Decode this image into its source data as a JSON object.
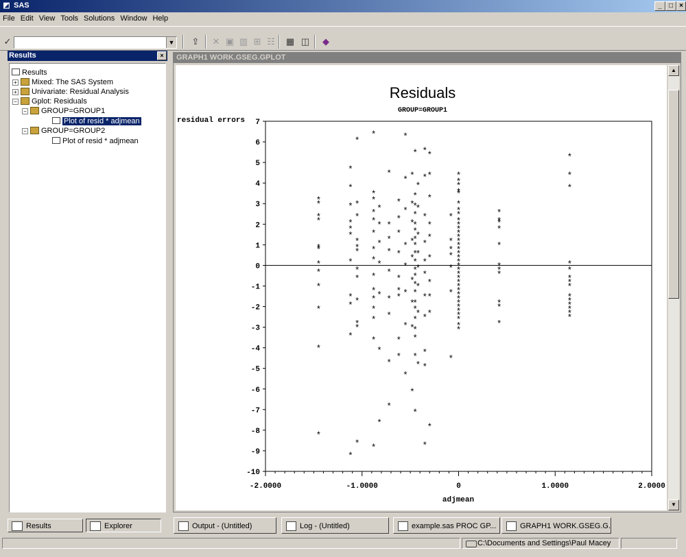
{
  "window": {
    "title": "SAS",
    "min": "_",
    "max": "□",
    "close": "×"
  },
  "menu": [
    "File",
    "Edit",
    "View",
    "Tools",
    "Solutions",
    "Window",
    "Help"
  ],
  "toolbar": {
    "check_glyph": "✓",
    "command_value": "",
    "drop_glyph": "▼"
  },
  "results": {
    "title": "Results",
    "close": "×",
    "tree": {
      "root": "Results",
      "mixed": "Mixed:  The SAS System",
      "univariate": "Univariate:  Residual Analysis",
      "gplot": "Gplot:  Residuals",
      "group1": "GROUP=GROUP1",
      "group1_plot": "Plot of resid * adjmean",
      "group2": "GROUP=GROUP2",
      "group2_plot": "Plot of resid * adjmean"
    },
    "tabs": [
      "Results",
      "Explorer"
    ]
  },
  "graph": {
    "window_title": "GRAPH1  WORK.GSEG.GPLOT"
  },
  "taskbar": [
    "Output - (Untitled)",
    "Log - (Untitled)",
    "example.sas   PROC GP...",
    "GRAPH1  WORK.GSEG.G..."
  ],
  "status": {
    "path": "C:\\Documents and Settings\\Paul Macey"
  },
  "chart_data": {
    "type": "scatter",
    "title": "Residuals",
    "subtitle": "GROUP=GROUP1",
    "ylabel": "residual errors",
    "xlabel": "adjmean",
    "marker": "*",
    "xlim": [
      -2.0,
      2.0
    ],
    "ylim": [
      -10,
      7
    ],
    "xticks": [
      "-2.0000",
      "-1.0000",
      "0",
      "1.0000",
      "2.0000"
    ],
    "yticks": [
      "7",
      "6",
      "5",
      "4",
      "3",
      "2",
      "1",
      "0",
      "-1",
      "-2",
      "-3",
      "-4",
      "-5",
      "-6",
      "-7",
      "-8",
      "-9",
      "-10"
    ],
    "reference_line_y": 0,
    "points": [
      [
        -1.45,
        3.2
      ],
      [
        -1.45,
        3.0
      ],
      [
        -1.45,
        2.4
      ],
      [
        -1.45,
        2.2
      ],
      [
        -1.45,
        0.9
      ],
      [
        -1.45,
        0.8
      ],
      [
        -1.45,
        0.1
      ],
      [
        -1.45,
        -0.3
      ],
      [
        -1.45,
        -1.0
      ],
      [
        -1.45,
        -2.1
      ],
      [
        -1.45,
        -4.0
      ],
      [
        -1.45,
        -8.2
      ],
      [
        -1.12,
        4.7
      ],
      [
        -1.12,
        3.8
      ],
      [
        -1.12,
        2.9
      ],
      [
        -1.12,
        2.1
      ],
      [
        -1.12,
        1.8
      ],
      [
        -1.12,
        1.5
      ],
      [
        -1.12,
        0.2
      ],
      [
        -1.12,
        -1.5
      ],
      [
        -1.12,
        -1.9
      ],
      [
        -1.12,
        -3.4
      ],
      [
        -1.12,
        -9.2
      ],
      [
        -1.05,
        6.1
      ],
      [
        -1.05,
        3.0
      ],
      [
        -1.05,
        2.4
      ],
      [
        -1.05,
        1.2
      ],
      [
        -1.05,
        0.9
      ],
      [
        -1.05,
        0.7
      ],
      [
        -1.05,
        -0.2
      ],
      [
        -1.05,
        -0.6
      ],
      [
        -1.05,
        -1.7
      ],
      [
        -1.05,
        -2.8
      ],
      [
        -1.05,
        -3.0
      ],
      [
        -1.05,
        -8.6
      ],
      [
        -0.88,
        6.4
      ],
      [
        -0.88,
        3.5
      ],
      [
        -0.88,
        3.2
      ],
      [
        -0.88,
        2.6
      ],
      [
        -0.88,
        2.2
      ],
      [
        -0.88,
        1.6
      ],
      [
        -0.88,
        0.8
      ],
      [
        -0.88,
        0.3
      ],
      [
        -0.88,
        -0.5
      ],
      [
        -0.88,
        -1.2
      ],
      [
        -0.88,
        -1.6
      ],
      [
        -0.88,
        -2.1
      ],
      [
        -0.88,
        -2.6
      ],
      [
        -0.88,
        -3.6
      ],
      [
        -0.88,
        -8.8
      ],
      [
        -0.82,
        2.8
      ],
      [
        -0.82,
        2.0
      ],
      [
        -0.82,
        1.1
      ],
      [
        -0.82,
        0.1
      ],
      [
        -0.82,
        -1.4
      ],
      [
        -0.82,
        -4.1
      ],
      [
        -0.82,
        -7.6
      ],
      [
        -0.72,
        4.5
      ],
      [
        -0.72,
        2.0
      ],
      [
        -0.72,
        1.3
      ],
      [
        -0.72,
        0.7
      ],
      [
        -0.72,
        -0.3
      ],
      [
        -0.72,
        -1.6
      ],
      [
        -0.72,
        -2.4
      ],
      [
        -0.72,
        -4.7
      ],
      [
        -0.72,
        -6.8
      ],
      [
        -0.62,
        3.1
      ],
      [
        -0.62,
        2.3
      ],
      [
        -0.62,
        1.6
      ],
      [
        -0.62,
        0.6
      ],
      [
        -0.62,
        -0.6
      ],
      [
        -0.62,
        -1.2
      ],
      [
        -0.62,
        -1.5
      ],
      [
        -0.62,
        -3.6
      ],
      [
        -0.62,
        -4.4
      ],
      [
        -0.55,
        6.3
      ],
      [
        -0.55,
        4.2
      ],
      [
        -0.55,
        2.7
      ],
      [
        -0.55,
        1.0
      ],
      [
        -0.55,
        0.0
      ],
      [
        -0.55,
        -1.3
      ],
      [
        -0.55,
        -2.9
      ],
      [
        -0.55,
        -5.3
      ],
      [
        -0.48,
        4.4
      ],
      [
        -0.48,
        3.0
      ],
      [
        -0.48,
        2.1
      ],
      [
        -0.48,
        1.2
      ],
      [
        -0.48,
        0.4
      ],
      [
        -0.48,
        -0.7
      ],
      [
        -0.48,
        -1.8
      ],
      [
        -0.48,
        -3.0
      ],
      [
        -0.48,
        -6.1
      ],
      [
        -0.45,
        5.5
      ],
      [
        -0.45,
        3.4
      ],
      [
        -0.45,
        2.9
      ],
      [
        -0.45,
        2.5
      ],
      [
        -0.45,
        2.0
      ],
      [
        -0.45,
        1.7
      ],
      [
        -0.45,
        1.3
      ],
      [
        -0.45,
        1.0
      ],
      [
        -0.45,
        0.6
      ],
      [
        -0.45,
        0.2
      ],
      [
        -0.45,
        -0.2
      ],
      [
        -0.45,
        -0.5
      ],
      [
        -0.45,
        -0.9
      ],
      [
        -0.45,
        -1.3
      ],
      [
        -0.45,
        -1.8
      ],
      [
        -0.45,
        -2.1
      ],
      [
        -0.45,
        -2.6
      ],
      [
        -0.45,
        -3.1
      ],
      [
        -0.45,
        -3.5
      ],
      [
        -0.45,
        -4.4
      ],
      [
        -0.45,
        -7.1
      ],
      [
        -0.42,
        3.9
      ],
      [
        -0.42,
        2.8
      ],
      [
        -0.42,
        1.5
      ],
      [
        -0.42,
        0.6
      ],
      [
        -0.42,
        -0.1
      ],
      [
        -0.42,
        -1.0
      ],
      [
        -0.42,
        -2.3
      ],
      [
        -0.42,
        -4.8
      ],
      [
        -0.35,
        5.6
      ],
      [
        -0.35,
        4.3
      ],
      [
        -0.35,
        2.4
      ],
      [
        -0.35,
        1.1
      ],
      [
        -0.35,
        0.2
      ],
      [
        -0.35,
        -0.4
      ],
      [
        -0.35,
        -1.5
      ],
      [
        -0.35,
        -2.5
      ],
      [
        -0.35,
        -4.2
      ],
      [
        -0.35,
        -4.9
      ],
      [
        -0.35,
        -8.7
      ],
      [
        -0.3,
        5.4
      ],
      [
        -0.3,
        4.4
      ],
      [
        -0.3,
        3.3
      ],
      [
        -0.3,
        2.0
      ],
      [
        -0.3,
        1.4
      ],
      [
        -0.3,
        0.4
      ],
      [
        -0.3,
        -0.8
      ],
      [
        -0.3,
        -1.5
      ],
      [
        -0.3,
        -2.3
      ],
      [
        -0.3,
        -7.8
      ],
      [
        -0.08,
        2.4
      ],
      [
        -0.08,
        1.2
      ],
      [
        -0.08,
        0.8
      ],
      [
        -0.08,
        0.5
      ],
      [
        -0.08,
        -0.1
      ],
      [
        -0.08,
        -1.3
      ],
      [
        -0.08,
        -4.5
      ],
      [
        0,
        4.4
      ],
      [
        0,
        4.1
      ],
      [
        0,
        3.9
      ],
      [
        0,
        3.6
      ],
      [
        0,
        3.5
      ],
      [
        0,
        3.0
      ],
      [
        0,
        2.7
      ],
      [
        0,
        2.5
      ],
      [
        0,
        2.2
      ],
      [
        0,
        2.0
      ],
      [
        0,
        1.8
      ],
      [
        0,
        1.6
      ],
      [
        0,
        1.4
      ],
      [
        0,
        1.2
      ],
      [
        0,
        1.0
      ],
      [
        0,
        0.8
      ],
      [
        0,
        0.6
      ],
      [
        0,
        0.4
      ],
      [
        0,
        0.2
      ],
      [
        0,
        0.0
      ],
      [
        0,
        -0.2
      ],
      [
        0,
        -0.4
      ],
      [
        0,
        -0.6
      ],
      [
        0,
        -0.8
      ],
      [
        0,
        -1.0
      ],
      [
        0,
        -1.2
      ],
      [
        0,
        -1.4
      ],
      [
        0,
        -1.6
      ],
      [
        0,
        -1.8
      ],
      [
        0,
        -2.0
      ],
      [
        0,
        -2.2
      ],
      [
        0,
        -2.4
      ],
      [
        0,
        -2.6
      ],
      [
        0,
        -2.9
      ],
      [
        0,
        -3.1
      ],
      [
        0.42,
        2.6
      ],
      [
        0.42,
        2.2
      ],
      [
        0.42,
        2.1
      ],
      [
        0.42,
        1.8
      ],
      [
        0.42,
        1.0
      ],
      [
        0.42,
        0.0
      ],
      [
        0.42,
        -0.2
      ],
      [
        0.42,
        -0.4
      ],
      [
        0.42,
        -1.8
      ],
      [
        0.42,
        -2.0
      ],
      [
        0.42,
        -2.8
      ],
      [
        1.15,
        5.3
      ],
      [
        1.15,
        4.4
      ],
      [
        1.15,
        3.8
      ],
      [
        1.15,
        0.1
      ],
      [
        1.15,
        -0.2
      ],
      [
        1.15,
        -0.6
      ],
      [
        1.15,
        -0.8
      ],
      [
        1.15,
        -1.0
      ],
      [
        1.15,
        -1.5
      ],
      [
        1.15,
        -1.7
      ],
      [
        1.15,
        -1.9
      ],
      [
        1.15,
        -2.1
      ],
      [
        1.15,
        -2.3
      ],
      [
        1.15,
        -2.5
      ]
    ]
  }
}
